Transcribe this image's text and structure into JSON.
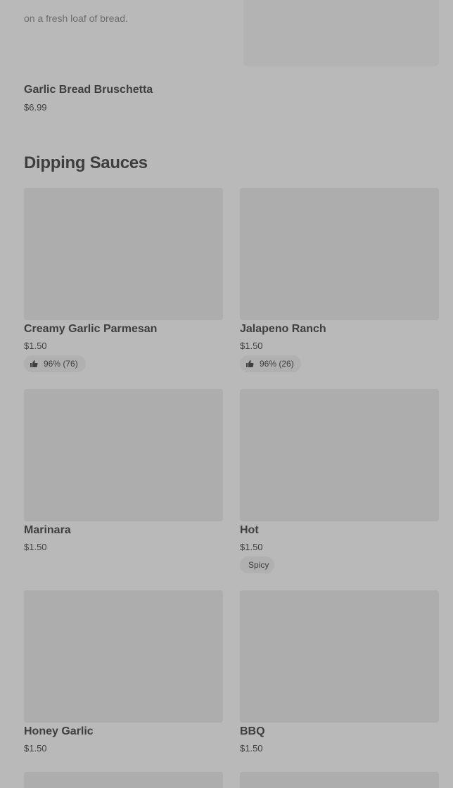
{
  "previous_item": {
    "description_tail": "on a fresh loaf of bread.",
    "title": "Garlic Bread Bruschetta",
    "price": "$6.99"
  },
  "section": {
    "title": "Dipping Sauces"
  },
  "items": [
    {
      "title": "Creamy Garlic Parmesan",
      "price": "$1.50",
      "badge": "96% (76)",
      "badge_icon": "thumbs-up-icon"
    },
    {
      "title": "Jalapeno Ranch",
      "price": "$1.50",
      "badge": "96% (26)",
      "badge_icon": "thumbs-up-icon"
    },
    {
      "title": "Marinara",
      "price": "$1.50"
    },
    {
      "title": "Hot",
      "price": "$1.50",
      "badge": "Spicy"
    },
    {
      "title": "Honey Garlic",
      "price": "$1.50"
    },
    {
      "title": "BBQ",
      "price": "$1.50"
    }
  ],
  "colors": {
    "overlay_background": "#b9b9b9",
    "image_placeholder": "#adadad",
    "badge_background": "#b0b0b0",
    "text": "#3e3e3e"
  }
}
